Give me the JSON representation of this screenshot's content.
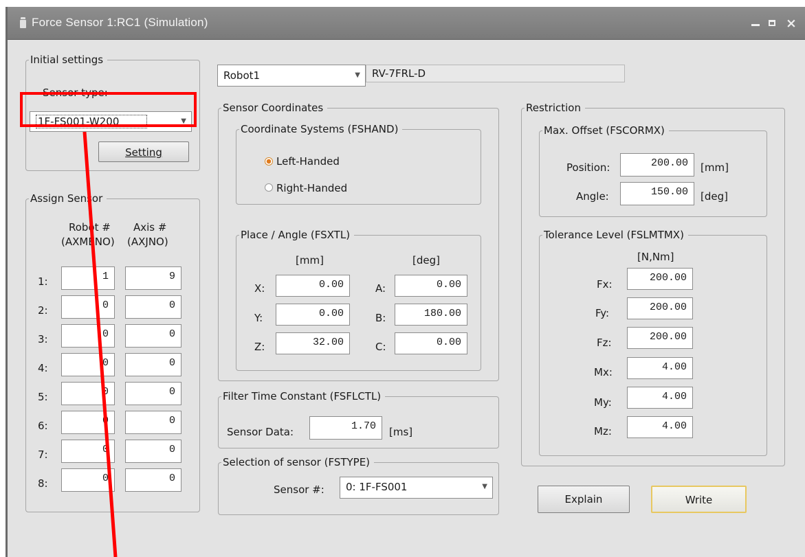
{
  "window": {
    "title": "Force Sensor 1:RC1  (Simulation)"
  },
  "initial_settings": {
    "group_label": "Initial settings",
    "sensor_type_label": "Sensor type:",
    "sensor_type_value": "1F-FS001-W200",
    "setting_button": "Setting"
  },
  "assign_sensor": {
    "group_label": "Assign Sensor",
    "col_robot": "Robot #",
    "col_robot_sub": "(AXMENO)",
    "col_axis": "Axis #",
    "col_axis_sub": "(AXJNO)",
    "rows": [
      {
        "label": "1:",
        "robot": "1",
        "axis": "9"
      },
      {
        "label": "2:",
        "robot": "0",
        "axis": "0"
      },
      {
        "label": "3:",
        "robot": "0",
        "axis": "0"
      },
      {
        "label": "4:",
        "robot": "0",
        "axis": "0"
      },
      {
        "label": "5:",
        "robot": "0",
        "axis": "0"
      },
      {
        "label": "6:",
        "robot": "0",
        "axis": "0"
      },
      {
        "label": "7:",
        "robot": "0",
        "axis": "0"
      },
      {
        "label": "8:",
        "robot": "0",
        "axis": "0"
      }
    ]
  },
  "robot": {
    "selected": "Robot1",
    "model": "RV-7FRL-D"
  },
  "sensor_coordinates": {
    "group_label": "Sensor Coordinates",
    "coord_systems_label": "Coordinate Systems (FSHAND)",
    "left_handed": "Left-Handed",
    "right_handed": "Right-Handed",
    "selected": "Left-Handed",
    "place_angle_label": "Place / Angle (FSXTL)",
    "unit_mm": "[mm]",
    "unit_deg": "[deg]",
    "x_label": "X:",
    "x": "0.00",
    "y_label": "Y:",
    "y": "0.00",
    "z_label": "Z:",
    "z": "32.00",
    "a_label": "A:",
    "a": "0.00",
    "b_label": "B:",
    "b": "180.00",
    "c_label": "C:",
    "c": "0.00"
  },
  "filter": {
    "group_label": "Filter Time Constant (FSFLCTL)",
    "sensor_data_label": "Sensor Data:",
    "sensor_data": "1.70",
    "unit": "[ms]"
  },
  "selection": {
    "group_label": "Selection of sensor (FSTYPE)",
    "sensor_label": "Sensor #:",
    "sensor_value": "0: 1F-FS001"
  },
  "restriction": {
    "group_label": "Restriction",
    "max_offset_label": "Max. Offset (FSCORMX)",
    "position_label": "Position:",
    "position": "200.00",
    "position_unit": "[mm]",
    "angle_label": "Angle:",
    "angle": "150.00",
    "angle_unit": "[deg]",
    "tolerance_label": "Tolerance Level (FSLMTMX)",
    "tolerance_unit": "[N,Nm]",
    "fx_label": "Fx:",
    "fx": "200.00",
    "fy_label": "Fy:",
    "fy": "200.00",
    "fz_label": "Fz:",
    "fz": "200.00",
    "mx_label": "Mx:",
    "mx": "4.00",
    "my_label": "My:",
    "my": "4.00",
    "mz_label": "Mz:",
    "mz": "4.00"
  },
  "buttons": {
    "explain": "Explain",
    "write": "Write"
  },
  "colors": {
    "highlight": "#ff0000",
    "write_border": "#e8c860",
    "radio_selected": "#e07b1f"
  }
}
